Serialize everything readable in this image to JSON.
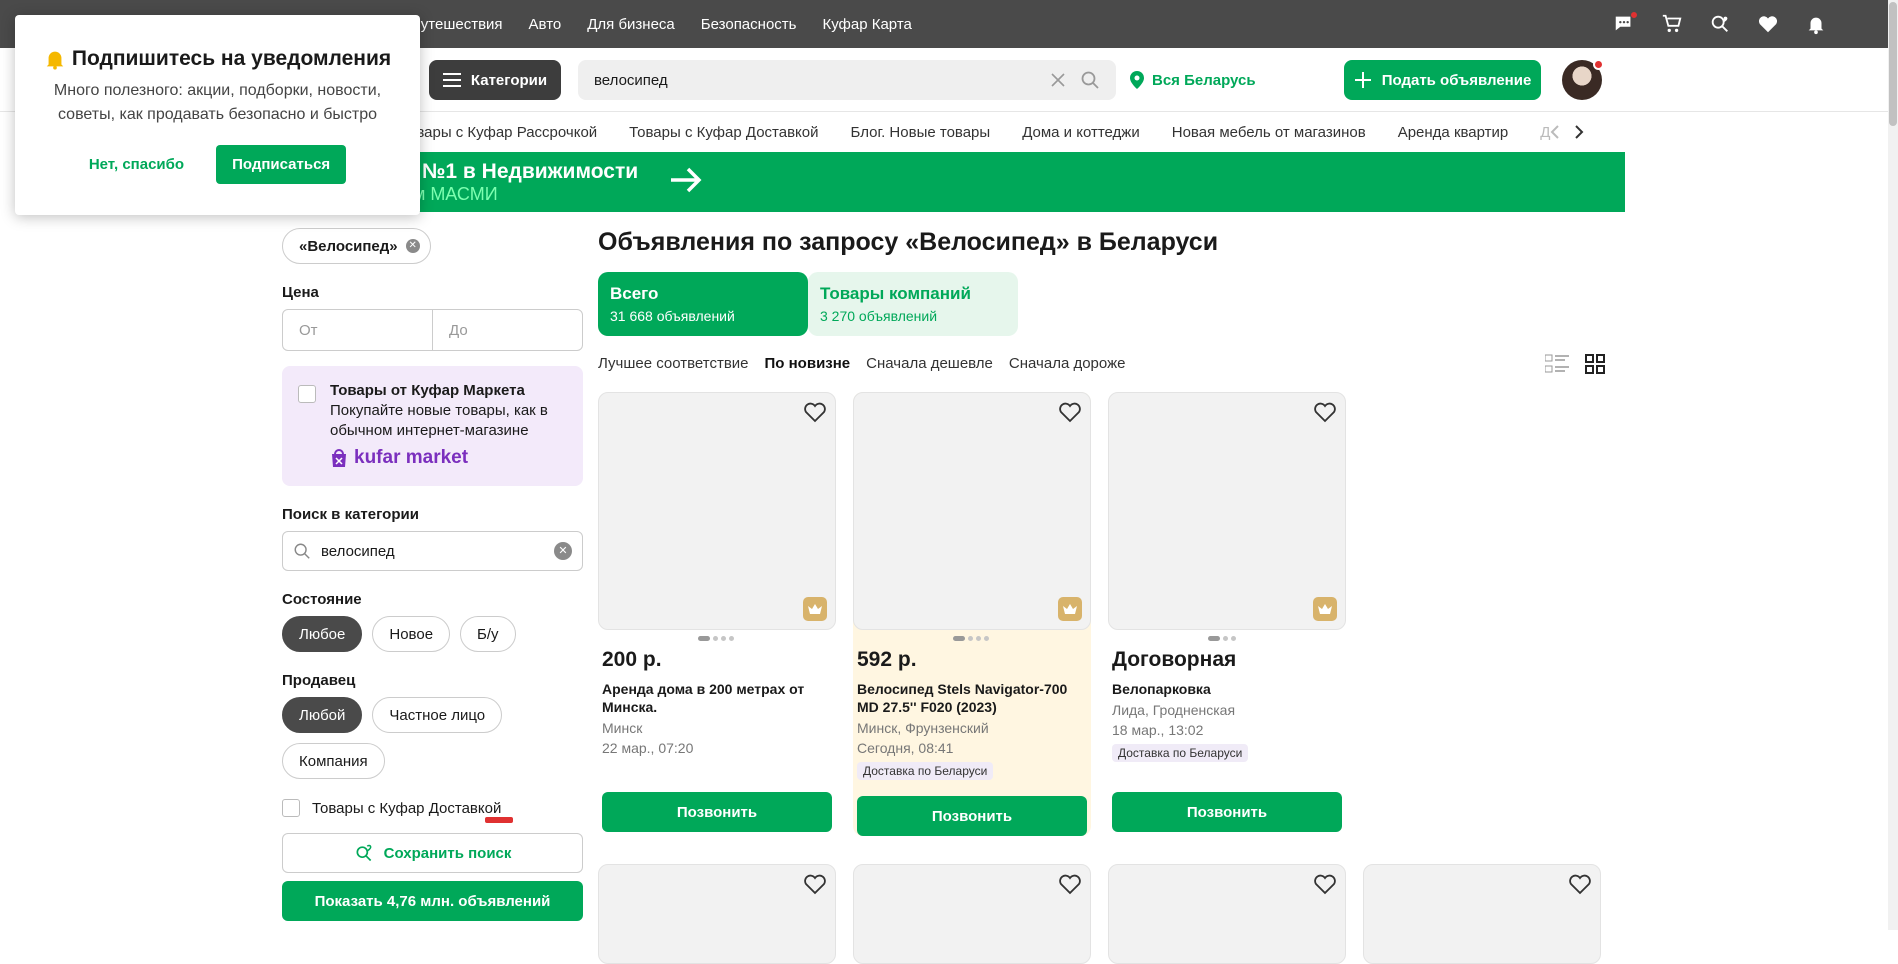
{
  "topnav": [
    "Путешествия",
    "Авто",
    "Для бизнеса",
    "Безопасность",
    "Куфар Карта"
  ],
  "popup": {
    "title": "Подпишитесь на уведомления",
    "body": "Много полезного: акции, подборки, новости, советы, как продавать безопасно и быстро",
    "no": "Нет, спасибо",
    "yes": "Подписаться"
  },
  "header": {
    "categories": "Категории",
    "search_value": "велосипед",
    "region": "Вся Беларусь",
    "post": "Подать объявление"
  },
  "links": [
    "Товары с Куфар Рассрочкой",
    "Товары с Куфар Доставкой",
    "Блог. Новые товары",
    "Дома и коттеджи",
    "Новая мебель от магазинов",
    "Аренда квартир",
    "Д"
  ],
  "banner": {
    "title": "№1 в Недвижимости",
    "subtitle": "ым МАСМИ"
  },
  "sidebar": {
    "query_chip": "«Велосипед»",
    "price_label": "Цена",
    "price_from": "От",
    "price_to": "До",
    "market_title": "Товары от Куфар Маркета",
    "market_desc": "Покупайте новые товары, как в обычном интернет-магазине",
    "market_logo": "kufar market",
    "cat_search_label": "Поиск в категории",
    "cat_search_value": "велосипед",
    "condition_label": "Состояние",
    "condition": [
      "Любое",
      "Новое",
      "Б/у"
    ],
    "seller_label": "Продавец",
    "seller": [
      "Любой",
      "Частное лицо",
      "Компания"
    ],
    "delivery": "Товары с Куфар Доставкой",
    "save": "Сохранить поиск",
    "show": "Показать 4,76 млн. объявлений"
  },
  "main": {
    "title": "Объявления по запросу «Велосипед» в Беларуси",
    "tab_all": "Всего",
    "tab_all_count": "31 668 объявлений",
    "tab_comp": "Товары компаний",
    "tab_comp_count": "3 270 объявлений",
    "sorts": [
      "Лучшее соответствие",
      "По новизне",
      "Сначала дешевле",
      "Сначала дороже"
    ]
  },
  "cards": [
    {
      "price": "200 р.",
      "title": "Аренда дома в 200 метрах от Минска.",
      "loc": "Минск",
      "date": "22 мар., 07:20",
      "call": "Позвонить"
    },
    {
      "price": "592 р.",
      "title": "Велосипед Stels Navigator-700 MD 27.5'' F020 (2023)",
      "loc": "Минск, Фрунзенский",
      "date": "Сегодня, 08:41",
      "badge": "Доставка по Беларуси",
      "call": "Позвонить"
    },
    {
      "price": "Договорная",
      "title": "Велопарковка",
      "loc": "Лида, Гродненская",
      "date": "18 мар., 13:02",
      "badge": "Доставка по Беларуси",
      "call": "Позвонить"
    }
  ],
  "colors": {
    "brand": "#00a859",
    "topbar": "#4a4a4a",
    "highlight": "#fff6e1"
  }
}
